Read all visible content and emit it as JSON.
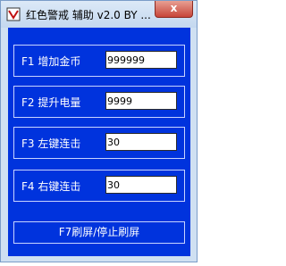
{
  "window": {
    "title": "红色警戒 辅助 v2.0 BY ...",
    "close_symbol": "x"
  },
  "rows": [
    {
      "label": "F1 增加金币",
      "value": "999999"
    },
    {
      "label": "F2 提升电量",
      "value": "9999"
    },
    {
      "label": "F3 左键连击",
      "value": "30"
    },
    {
      "label": "F4 右键连击",
      "value": "30"
    }
  ],
  "refresh_button": {
    "label": "F7刷屏/停止刷屏"
  },
  "colors": {
    "panel": "#0033dd",
    "frame": "#cfe0f2",
    "close": "#c7453a"
  },
  "icons": {
    "app": "app-icon",
    "close": "close-icon"
  }
}
